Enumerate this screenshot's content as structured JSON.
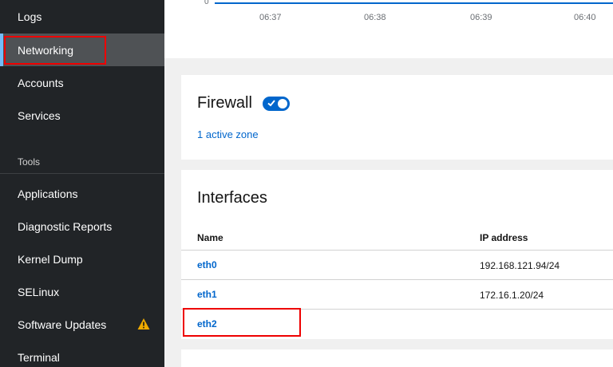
{
  "sidebar": {
    "items": [
      {
        "label": "Logs"
      },
      {
        "label": "Networking"
      },
      {
        "label": "Accounts"
      },
      {
        "label": "Services"
      }
    ],
    "tools_section": "Tools",
    "tool_items": [
      {
        "label": "Applications"
      },
      {
        "label": "Diagnostic Reports"
      },
      {
        "label": "Kernel Dump"
      },
      {
        "label": "SELinux"
      },
      {
        "label": "Software Updates"
      },
      {
        "label": "Terminal"
      }
    ],
    "warning_icon": "warning-triangle-icon"
  },
  "chart": {
    "y_zero": "0",
    "ticks": [
      "06:37",
      "06:38",
      "06:39",
      "06:40"
    ]
  },
  "firewall": {
    "title": "Firewall",
    "toggle_on": true,
    "active_zones_link": "1 active zone"
  },
  "interfaces": {
    "title": "Interfaces",
    "columns": [
      "Name",
      "IP address"
    ],
    "rows": [
      {
        "name": "eth0",
        "ip": "192.168.121.94/24"
      },
      {
        "name": "eth1",
        "ip": "172.16.1.20/24"
      },
      {
        "name": "eth2",
        "ip": ""
      }
    ]
  },
  "colors": {
    "accent": "#0066cc",
    "sidebar_bg": "#212427",
    "highlight": "#ee0000",
    "warning": "#f0ab00"
  }
}
